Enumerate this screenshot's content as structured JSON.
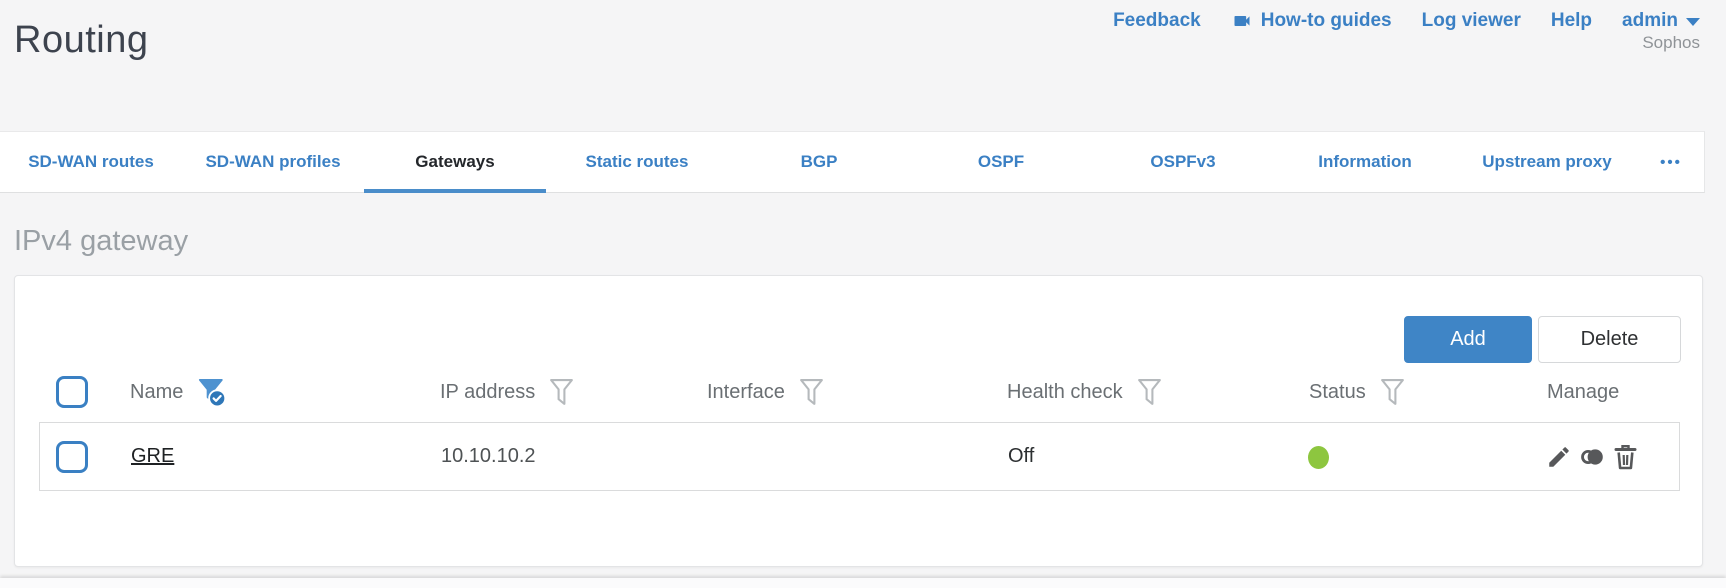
{
  "page": {
    "title": "Routing",
    "brand": "Sophos"
  },
  "topnav": {
    "items": [
      {
        "label": "Feedback"
      },
      {
        "label": "How-to guides",
        "icon": "video-camera-icon"
      },
      {
        "label": "Log viewer"
      },
      {
        "label": "Help"
      },
      {
        "label": "admin",
        "icon": "caret-down-icon"
      }
    ]
  },
  "tabs": {
    "items": [
      {
        "label": "SD-WAN routes",
        "active": false
      },
      {
        "label": "SD-WAN profiles",
        "active": false
      },
      {
        "label": "Gateways",
        "active": true
      },
      {
        "label": "Static routes",
        "active": false
      },
      {
        "label": "BGP",
        "active": false
      },
      {
        "label": "OSPF",
        "active": false
      },
      {
        "label": "OSPFv3",
        "active": false
      },
      {
        "label": "Information",
        "active": false
      },
      {
        "label": "Upstream proxy",
        "active": false
      }
    ],
    "more": "•••"
  },
  "section": {
    "heading": "IPv4 gateway"
  },
  "toolbar": {
    "add_label": "Add",
    "delete_label": "Delete"
  },
  "table": {
    "columns": [
      {
        "label": "Name",
        "filter": "active"
      },
      {
        "label": "IP address",
        "filter": "default"
      },
      {
        "label": "Interface",
        "filter": "default"
      },
      {
        "label": "Health check",
        "filter": "default"
      },
      {
        "label": "Status",
        "filter": "default"
      },
      {
        "label": "Manage",
        "filter": "none"
      }
    ],
    "rows": [
      {
        "name": "GRE",
        "ip_address": "10.10.10.2",
        "interface": "",
        "health_check": "Off",
        "status": "up"
      }
    ]
  },
  "icons": {
    "howto": "video-camera-icon",
    "admin_menu": "caret-down-icon",
    "filter_active": "funnel-check-icon",
    "filter": "funnel-icon",
    "edit": "pencil-icon",
    "clone": "clone-icon",
    "delete": "trash-icon",
    "status_up": "green-dot-icon"
  },
  "colors": {
    "accent_blue": "#3b80c4",
    "tab_underline": "#4a8dca",
    "add_button": "#3f85c6",
    "status_green": "#8dc63f",
    "heading_gray": "#9aa0a5"
  }
}
